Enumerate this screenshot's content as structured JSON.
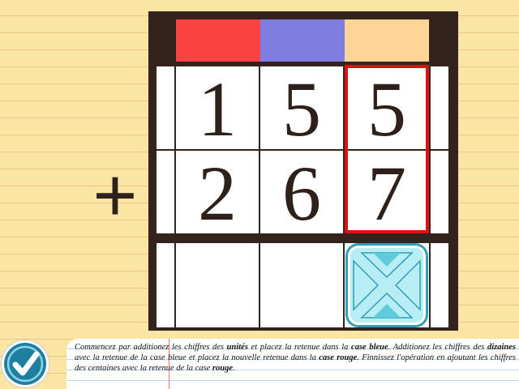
{
  "board": {
    "carry_boxes": [
      {
        "role": "centaines",
        "color": "#fb4242"
      },
      {
        "role": "dizaines",
        "color": "#7f7ddf"
      },
      {
        "role": "unites",
        "color": "#ffd597"
      }
    ],
    "operator": "+",
    "rows": [
      {
        "digits": [
          "1",
          "5",
          "5"
        ]
      },
      {
        "digits": [
          "2",
          "6",
          "7"
        ]
      }
    ],
    "result": [
      "",
      "",
      ""
    ],
    "highlight_color": "#e01010"
  },
  "controls": {
    "check_icon": "checkmark-icon",
    "answer_icon": "hourglass-arrows-icon"
  },
  "instructions": {
    "p1": "Commencez par additionez les chiffres des ",
    "b1": "unités",
    "p2": " et placez la retenue dans la ",
    "b2": "case bleue",
    "p3": ". Additionez les chiffres des ",
    "b3": "dizaines",
    "p4": " avec la retenue de la case bleue et placez la nouvelle retenue dans la ",
    "b4": "case rouge",
    "p5": ". Finnissez l'opération en ajoutant les chiffres des centaines avec la retenue de la case ",
    "b5": "rouge",
    "p6": "."
  }
}
